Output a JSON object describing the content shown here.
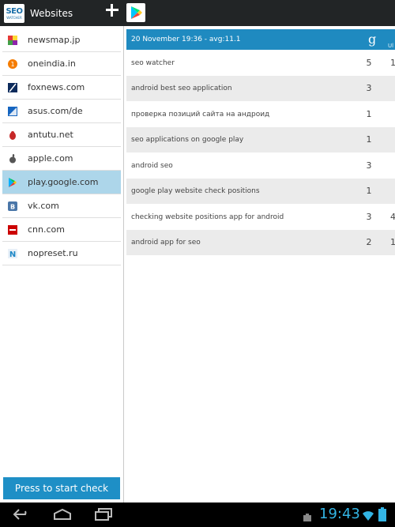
{
  "app": {
    "title": "Websites",
    "logo_top": "SEO",
    "logo_bottom": "WATCHER"
  },
  "toolbar": {
    "add_icon": "plus-icon",
    "play_icon": "google-play-icon"
  },
  "sidebar": {
    "items": [
      {
        "label": "newsmap.jp",
        "icon": "newsmap-favicon",
        "selected": false
      },
      {
        "label": "oneindia.in",
        "icon": "oneindia-favicon",
        "selected": false
      },
      {
        "label": "foxnews.com",
        "icon": "foxnews-favicon",
        "selected": false
      },
      {
        "label": "asus.com/de",
        "icon": "asus-favicon",
        "selected": false
      },
      {
        "label": "antutu.net",
        "icon": "antutu-favicon",
        "selected": false
      },
      {
        "label": "apple.com",
        "icon": "apple-favicon",
        "selected": false
      },
      {
        "label": "play.google.com",
        "icon": "google-play-favicon",
        "selected": true
      },
      {
        "label": "vk.com",
        "icon": "vk-favicon",
        "selected": false
      },
      {
        "label": "cnn.com",
        "icon": "cnn-favicon",
        "selected": false
      },
      {
        "label": "nopreset.ru",
        "icon": "nopreset-favicon",
        "selected": false
      }
    ],
    "start_button": "Press to start check"
  },
  "main": {
    "header": "20 November 19:36 - avg:11.1",
    "engine_icon": "google-g-icon",
    "second_column_partial": "Ul",
    "rows": [
      {
        "keyword": "seo watcher",
        "position": "5",
        "position2": "1"
      },
      {
        "keyword": "android best seo application",
        "position": "3",
        "position2": ""
      },
      {
        "keyword": "проверка позиций сайта на андроид",
        "position": "1",
        "position2": ""
      },
      {
        "keyword": "seo applications on google play",
        "position": "1",
        "position2": ""
      },
      {
        "keyword": "android seo",
        "position": "3",
        "position2": ""
      },
      {
        "keyword": "google play website check positions",
        "position": "1",
        "position2": ""
      },
      {
        "keyword": "checking website positions app for android",
        "position": "3",
        "position2": "4"
      },
      {
        "keyword": "android app for seo",
        "position": "2",
        "position2": "1"
      }
    ]
  },
  "statusbar": {
    "time": "19:43"
  },
  "navbar": {
    "back_icon": "back-icon",
    "home_icon": "home-icon",
    "recents_icon": "recent-apps-icon",
    "wifi_icon": "wifi-icon",
    "battery_icon": "battery-icon"
  },
  "colors": {
    "accent": "#1e8fc6",
    "selected_bg": "#add6ea",
    "actionbar_bg": "#222526",
    "clock": "#33b5e5"
  }
}
